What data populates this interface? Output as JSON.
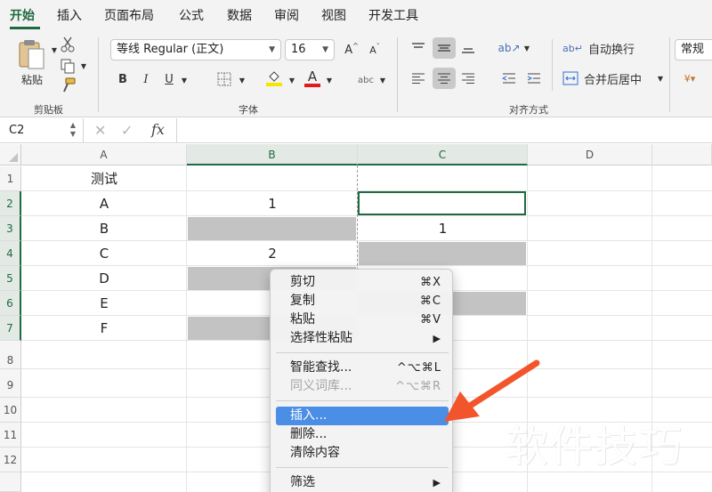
{
  "ribbon_tabs": [
    "开始",
    "插入",
    "页面布局",
    "公式",
    "数据",
    "审阅",
    "视图",
    "开发工具"
  ],
  "ribbon": {
    "clipboard": {
      "paste_label": "粘贴",
      "group_label": "剪贴板"
    },
    "font": {
      "name": "等线 Regular (正文)",
      "size": "16",
      "grow": "A",
      "shrink": "A",
      "bold": "B",
      "italic": "I",
      "underline": "U",
      "phonetic": "abc",
      "group_label": "字体"
    },
    "alignment": {
      "wrap_text": "自动换行",
      "merge_center": "合并后居中",
      "group_label": "对齐方式"
    },
    "number": {
      "format": "常规"
    }
  },
  "formula_bar": {
    "name_box": "C2",
    "fx": "fx",
    "value": ""
  },
  "grid": {
    "columns": [
      "A",
      "B",
      "C",
      "D"
    ],
    "rows": [
      "1",
      "2",
      "3",
      "4",
      "5",
      "6",
      "7",
      "8",
      "9",
      "10",
      "11",
      "12"
    ],
    "cells": {
      "A1": "测试",
      "A2": "A",
      "A3": "B",
      "A4": "C",
      "A5": "D",
      "A6": "E",
      "A7": "F",
      "B2": "1",
      "C3": "1",
      "B4": "2"
    }
  },
  "context_menu": {
    "items": [
      {
        "label": "剪切",
        "shortcut": "⌘X",
        "enabled": true
      },
      {
        "label": "复制",
        "shortcut": "⌘C",
        "enabled": true
      },
      {
        "label": "粘贴",
        "shortcut": "⌘V",
        "enabled": true
      },
      {
        "label": "选择性粘贴",
        "shortcut": "▶",
        "enabled": true
      },
      {
        "label": "智能查找...",
        "shortcut": "^⌥⌘L",
        "enabled": true
      },
      {
        "label": "同义词库...",
        "shortcut": "^⌥⌘R",
        "enabled": false
      },
      {
        "label": "插入...",
        "shortcut": "",
        "enabled": true,
        "highlighted": true
      },
      {
        "label": "删除...",
        "shortcut": "",
        "enabled": true
      },
      {
        "label": "清除内容",
        "shortcut": "",
        "enabled": true
      },
      {
        "label": "筛选",
        "shortcut": "▶",
        "enabled": true
      }
    ]
  },
  "watermark": "软件技巧",
  "colors": {
    "accent": "#1f6b3f",
    "menu_highlight": "#4a8ee6",
    "arrow": "#f2552c",
    "fill_grey": "#c3c3c3"
  }
}
